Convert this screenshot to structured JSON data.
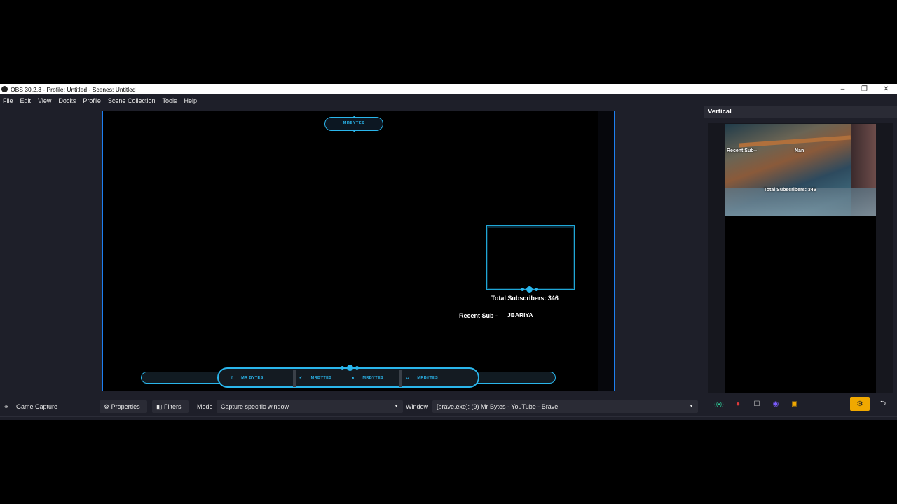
{
  "window": {
    "title": "OBS 30.2.3 - Profile: Untitled - Scenes: Untitled",
    "controls": {
      "minimize": "–",
      "restore": "❐",
      "close": "✕"
    }
  },
  "menu": [
    "File",
    "Edit",
    "View",
    "Docks",
    "Profile",
    "Scene Collection",
    "Tools",
    "Help"
  ],
  "preview": {
    "top_pill_text": "MRBYTES",
    "subscribers_text": "Total Subscribers: 346",
    "recent_sub_label": "Recent Sub -",
    "recent_sub_name": "JBARIYA",
    "bottom_segments": [
      "MR BYTES",
      "MRBYTES_",
      "MRBYTES_",
      "MRBYTES"
    ],
    "accent_color": "#2ab6ec",
    "selection_border_color": "#1e7ff0"
  },
  "vertical_dock": {
    "title": "Vertical",
    "overlay": {
      "recent_sub": "Recent Sub--",
      "name": "Nan",
      "total_subs": "Total Subscribers: 346"
    },
    "controls": [
      "stream-icon",
      "record-icon",
      "square-icon",
      "cam-icon",
      "replay-icon",
      "gear-icon",
      "back-icon"
    ]
  },
  "source_toolbar": {
    "source_name": "Game Capture",
    "properties_label": "Properties",
    "filters_label": "Filters",
    "mode_label": "Mode",
    "mode_value": "Capture specific window",
    "window_label": "Window",
    "window_value": "[brave.exe]: (9) Mr Bytes - YouTube - Brave"
  }
}
